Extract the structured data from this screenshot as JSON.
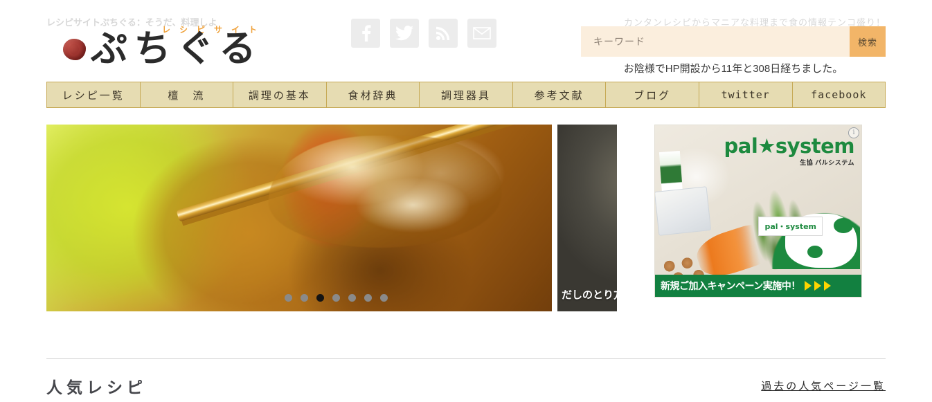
{
  "header": {
    "tagline_left": "レシピサイトぷちぐる：そうだ、料理しよ",
    "tagline_right": "カンタンレシピからマニアな料理まで食の情報テンコ盛り！",
    "logo": {
      "kana_small": "レシピサイト",
      "text": "ぷちぐる",
      "seal_name": "red-seal-icon"
    },
    "social": [
      {
        "name": "facebook-icon",
        "label": "Facebook"
      },
      {
        "name": "twitter-icon",
        "label": "Twitter"
      },
      {
        "name": "rss-icon",
        "label": "RSS"
      },
      {
        "name": "mail-icon",
        "label": "Mail"
      }
    ],
    "search": {
      "placeholder": "キーワード",
      "value": "",
      "button_label": "検索"
    },
    "anniversary": "お陰様でHP開設から11年と308日経ちました。"
  },
  "nav": {
    "items": [
      {
        "label": "レシピ一覧",
        "mono": false
      },
      {
        "label": "檀　流",
        "mono": false
      },
      {
        "label": "調理の基本",
        "mono": false
      },
      {
        "label": "食材辞典",
        "mono": false
      },
      {
        "label": "調理器具",
        "mono": false
      },
      {
        "label": "参考文献",
        "mono": false
      },
      {
        "label": "ブログ",
        "mono": false
      },
      {
        "label": "twitter",
        "mono": true
      },
      {
        "label": "facebook",
        "mono": true
      }
    ]
  },
  "slider": {
    "current_index": 3,
    "dot_count": 7,
    "next_slide_caption": "だしのとり方"
  },
  "ad": {
    "logo_main": "pal",
    "logo_star": "★",
    "logo_main2": "system",
    "logo_sub": "生協 パルシステム",
    "badge": "pal・system",
    "banner_text": "新規ご加入キャンペーン実施中！",
    "arrow_count": 3,
    "info_glyph": "i",
    "accent_green": "#128040",
    "arrow_color": "#ffd400"
  },
  "popular": {
    "title": "人気レシピ",
    "link": "過去の人気ページ一覧"
  },
  "colors": {
    "nav_bg": "#e6dcb2",
    "nav_border": "#c6a955",
    "search_bg": "#fbeedd",
    "search_button": "#f2b568",
    "logo_orange": "#efa13a"
  }
}
